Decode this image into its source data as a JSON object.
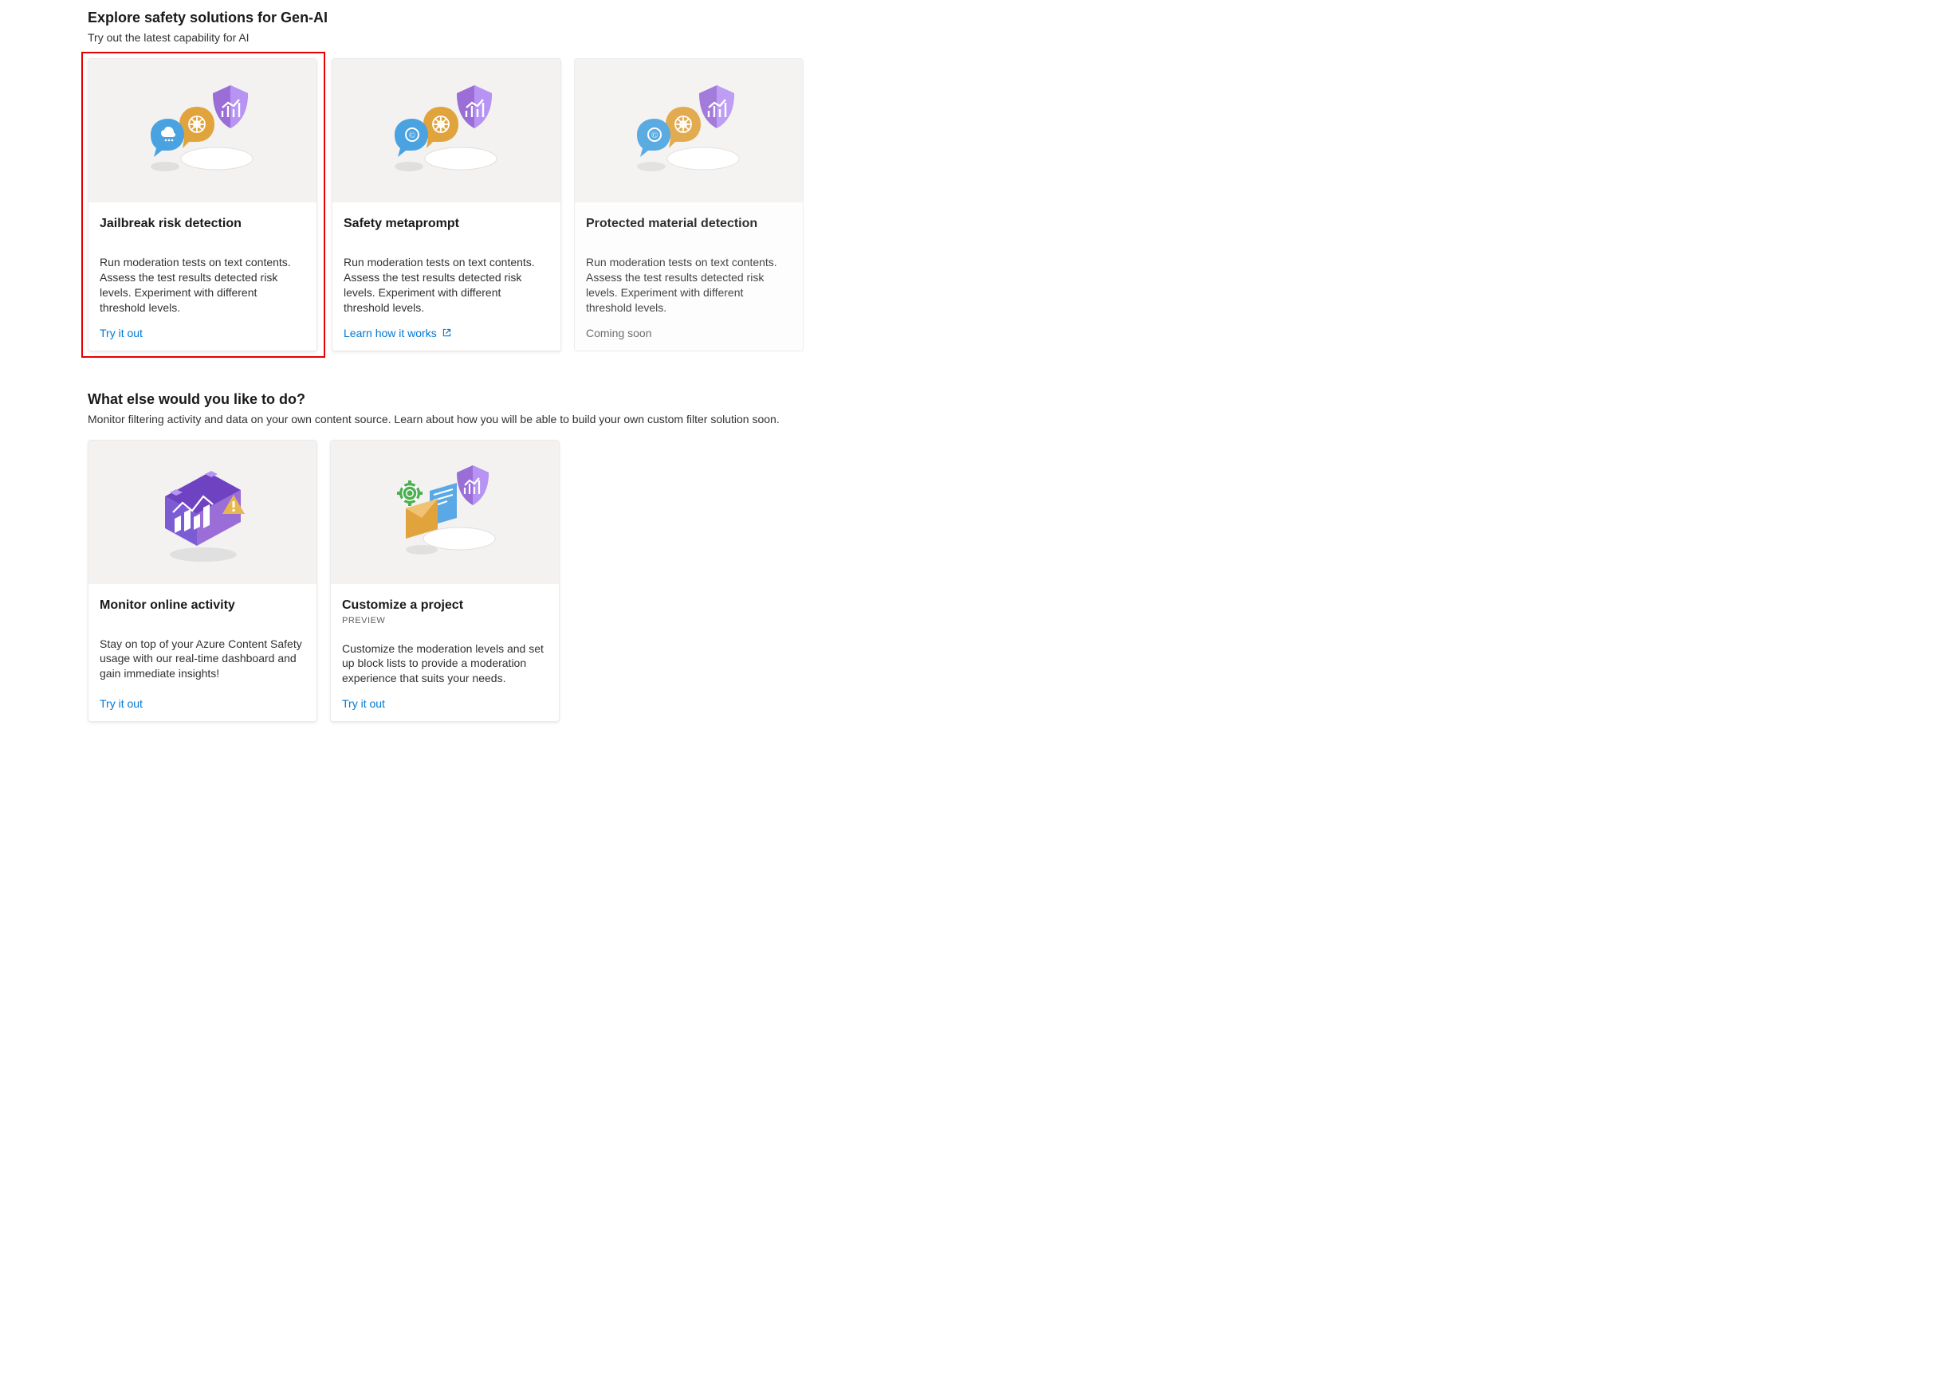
{
  "colors": {
    "link": "#0078d4",
    "highlight_border": "#e60000",
    "hero_bg": "#f3f2f1"
  },
  "sections": {
    "explore": {
      "title": "Explore safety solutions for Gen-AI",
      "subtitle": "Try out the latest capability for AI",
      "cards": [
        {
          "title": "Jailbreak risk detection",
          "desc": "Run moderation tests on text contents. Assess the test results detected risk levels. Experiment with different threshold levels.",
          "cta": "Try it out"
        },
        {
          "title": "Safety metaprompt",
          "desc": "Run moderation tests on text contents. Assess the test results detected risk levels. Experiment with different threshold levels.",
          "cta": "Learn how it works"
        },
        {
          "title": "Protected material detection",
          "desc": "Run moderation tests on text contents. Assess the test results detected risk levels. Experiment with different threshold levels.",
          "status": "Coming soon"
        }
      ]
    },
    "more": {
      "title": "What else would you like to do?",
      "subtitle": "Monitor filtering activity and data on your own content source. Learn about how you will be able to build your own custom filter solution soon.",
      "cards": [
        {
          "title": "Monitor online activity",
          "desc": "Stay on top of your Azure Content Safety usage with our real-time dashboard and gain immediate insights!",
          "cta": "Try it out"
        },
        {
          "title": "Customize a project",
          "badge": "PREVIEW",
          "desc": "Customize the moderation levels and set up block lists to provide a moderation experience that suits your needs.",
          "cta": "Try it out"
        }
      ]
    }
  }
}
